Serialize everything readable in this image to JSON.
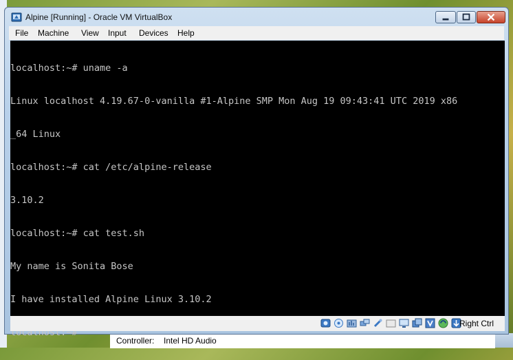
{
  "window": {
    "title": "Alpine [Running] - Oracle VM VirtualBox"
  },
  "menu": {
    "items": [
      "File",
      "Machine",
      "View",
      "Input",
      "Devices",
      "Help"
    ]
  },
  "console": {
    "lines": [
      "localhost:~# uname -a",
      "Linux localhost 4.19.67-0-vanilla #1-Alpine SMP Mon Aug 19 09:43:41 UTC 2019 x86",
      "_64 Linux",
      "localhost:~# cat /etc/alpine-release",
      "3.10.2",
      "localhost:~# cat test.sh",
      "My name is Sonita Bose",
      "I have installed Alpine Linux 3.10.2",
      "localhost:~#"
    ]
  },
  "statusbar": {
    "host_key": "Right Ctrl",
    "icons": [
      "hard-disk-icon",
      "optical-drive-icon",
      "audio-icon",
      "network-icon",
      "usb-icon",
      "shared-folders-icon",
      "display-icon",
      "video-capture-icon",
      "cpu-icon",
      "virtualization-icon",
      "mouse-integration-icon",
      "keyboard-capture-icon"
    ]
  },
  "background_panel": {
    "controller_label": "Controller:",
    "controller_value": "Intel HD Audio"
  },
  "colors": {
    "console_bg": "#000000",
    "console_text": "#c6c6c6",
    "close_button": "#c7432a"
  }
}
